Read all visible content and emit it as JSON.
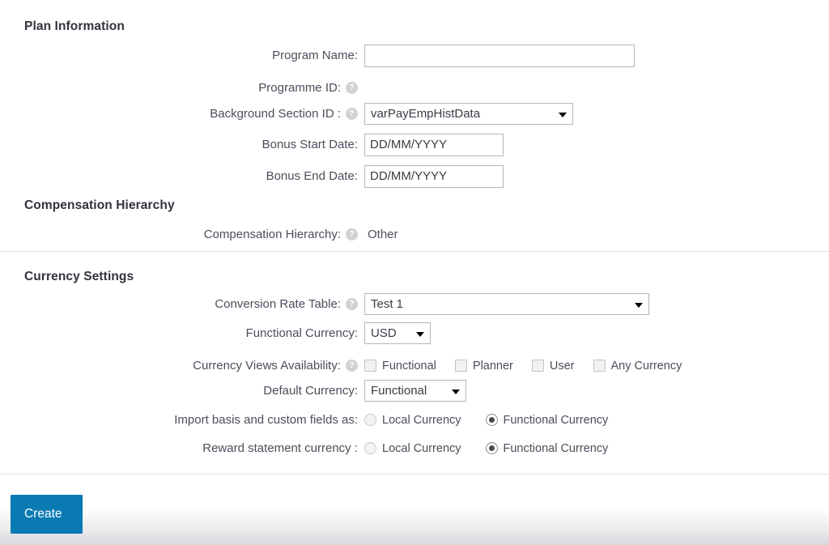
{
  "sections": {
    "plan_information": {
      "title": "Plan Information",
      "fields": {
        "program_name": {
          "label": "Program Name:",
          "value": "",
          "placeholder": ""
        },
        "programme_id": {
          "label": "Programme ID:",
          "help": "?"
        },
        "background_section_id": {
          "label": "Background Section ID :",
          "help": "?",
          "selected": "varPayEmpHistData",
          "options": [
            "varPayEmpHistData"
          ]
        },
        "bonus_start_date": {
          "label": "Bonus Start Date:",
          "value": "",
          "placeholder": "DD/MM/YYYY"
        },
        "bonus_end_date": {
          "label": "Bonus End Date:",
          "value": "",
          "placeholder": "DD/MM/YYYY"
        }
      }
    },
    "compensation_hierarchy": {
      "title": "Compensation Hierarchy",
      "fields": {
        "compensation_hierarchy": {
          "label": "Compensation Hierarchy:",
          "help": "?",
          "value": "Other"
        }
      }
    },
    "currency_settings": {
      "title": "Currency Settings",
      "fields": {
        "conversion_rate_table": {
          "label": "Conversion Rate Table:",
          "help": "?",
          "selected": "Test 1",
          "options": [
            "Test 1"
          ]
        },
        "functional_currency": {
          "label": "Functional Currency:",
          "selected": "USD",
          "options": [
            "USD"
          ]
        },
        "currency_views_availability": {
          "label": "Currency Views Availability:",
          "help": "?",
          "checkboxes": [
            {
              "label": "Functional",
              "checked": false
            },
            {
              "label": "Planner",
              "checked": false
            },
            {
              "label": "User",
              "checked": false
            },
            {
              "label": "Any Currency",
              "checked": false
            }
          ]
        },
        "default_currency": {
          "label": "Default Currency:",
          "selected": "Functional",
          "options": [
            "Functional"
          ]
        },
        "import_basis": {
          "label": "Import basis and custom fields as:",
          "radios": [
            {
              "label": "Local Currency",
              "checked": false
            },
            {
              "label": "Functional Currency",
              "checked": true
            }
          ]
        },
        "reward_statement_currency": {
          "label": "Reward statement currency :",
          "radios": [
            {
              "label": "Local Currency",
              "checked": false
            },
            {
              "label": "Functional Currency",
              "checked": true
            }
          ]
        }
      }
    }
  },
  "footer": {
    "create_label": "Create"
  },
  "colors": {
    "accent_blue": "#0a7ab3",
    "heading": "#32323c",
    "label": "#4d4d5c",
    "divider": "#e4e4e6",
    "help_icon": "#d2d2d2"
  }
}
